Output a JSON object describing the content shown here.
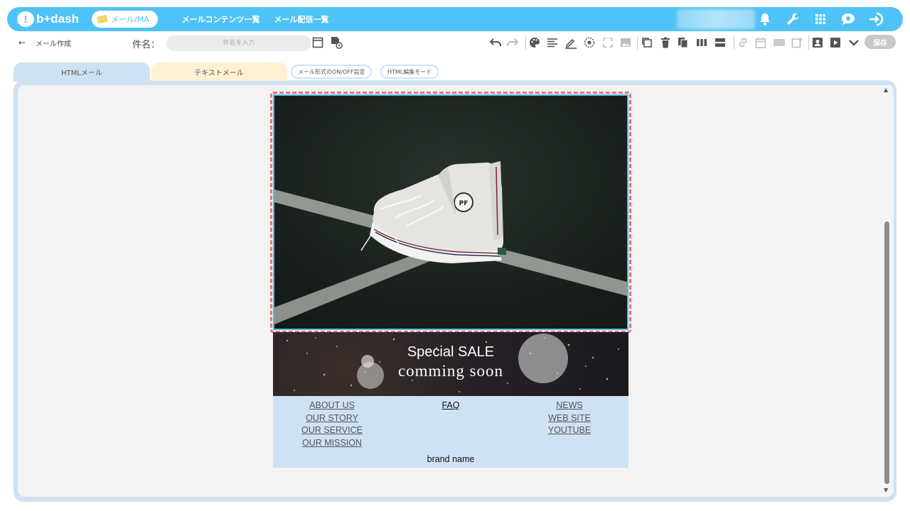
{
  "app": {
    "logo_text": "b+dash",
    "logo_mark": "!",
    "mode_label": "メール/MA",
    "nav": [
      "メールコンテンツ一覧",
      "メール配信一覧"
    ]
  },
  "toolbar": {
    "back_symbol": "←",
    "title": "メール作成",
    "subject_label": "件名：",
    "subject_placeholder": "件名を入力",
    "save_label": "保存"
  },
  "tabs": {
    "html": "HTMLメール",
    "text": "テキストメール",
    "onoff": "メール形式のON/OFF設定",
    "html_edit": "HTML編集モード"
  },
  "email": {
    "banner_line1": "Special SALE",
    "banner_line2": "comming soon",
    "footer_left": [
      "ABOUT US",
      "OUR STORY",
      "OUR SERVICE",
      "OUR MISSION"
    ],
    "footer_center": [
      "FAQ"
    ],
    "footer_right": [
      "NEWS",
      "WEB SITE",
      "YOUTUBE"
    ],
    "brand": "brand name"
  },
  "colors": {
    "primary": "#4fc3f7",
    "tab_html": "#cfe2f3",
    "tab_text": "#fdf1d3",
    "selection": "#ee6e7a"
  }
}
